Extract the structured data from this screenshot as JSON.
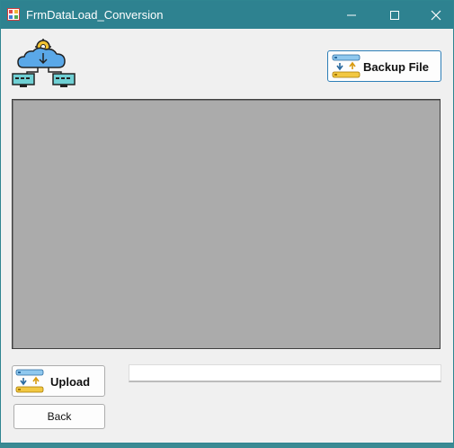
{
  "window": {
    "title": "FrmDataLoad_Conversion",
    "controls": {
      "minimize": "minimize",
      "maximize": "maximize",
      "close": "close"
    }
  },
  "logo": {
    "icon": "cloud-network-icon"
  },
  "buttons": {
    "backup": {
      "label": "Backup File",
      "icon": "database-transfer-icon"
    },
    "upload": {
      "label": "Upload",
      "icon": "database-transfer-icon"
    },
    "back": {
      "label": "Back"
    }
  },
  "data_grid": {
    "background": "#ababab",
    "rows": []
  },
  "progress": {
    "value": 0
  },
  "colors": {
    "titlebar": "#2e8290",
    "window": "#f0f0f0",
    "accent": "#2e7fb8"
  }
}
